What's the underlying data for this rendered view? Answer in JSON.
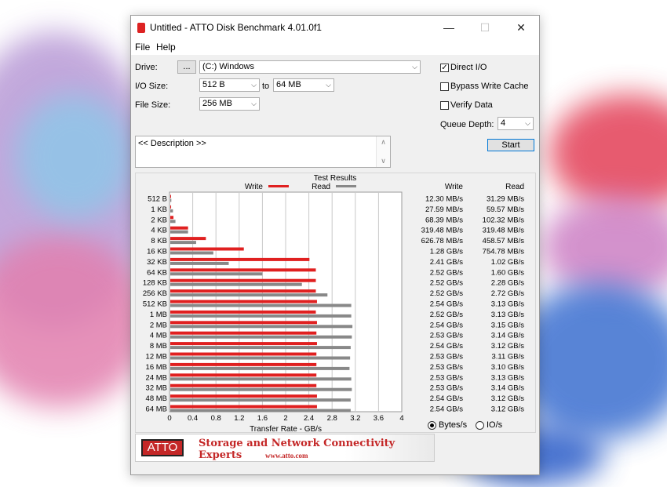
{
  "window": {
    "title": "Untitled - ATTO Disk Benchmark 4.01.0f1",
    "minimize_glyph": "—",
    "maximize_glyph": "☐",
    "close_glyph": "✕"
  },
  "menu": {
    "file": "File",
    "help": "Help"
  },
  "settings": {
    "drive_label": "Drive:",
    "drive_browse": "...",
    "drive_value": "(C:) Windows",
    "io_size_label": "I/O Size:",
    "io_size_from": "512 B",
    "io_to_label": "to",
    "io_size_to": "64 MB",
    "file_size_label": "File Size:",
    "file_size_value": "256 MB",
    "direct_io_label": "Direct I/O",
    "direct_io_checked": true,
    "bypass_write_cache_label": "Bypass Write Cache",
    "verify_data_label": "Verify Data",
    "queue_depth_label": "Queue Depth:",
    "queue_depth_value": "4",
    "start_label": "Start",
    "description": "<< Description >>",
    "check_glyph": "✓",
    "arrow_glyph": "⌵",
    "scroll_up_glyph": "∧",
    "scroll_down_glyph": "∨"
  },
  "results": {
    "write_col": "Write",
    "read_col": "Read",
    "bytes_label": "Bytes/s",
    "io_label": "IO/s",
    "bytes_selected": true
  },
  "chart_data": {
    "type": "bar",
    "title": "Test Results",
    "xlabel": "Transfer Rate - GB/s",
    "xlim": [
      0,
      4
    ],
    "x_ticks": [
      "0",
      "0.4",
      "0.8",
      "1.2",
      "1.6",
      "2",
      "2.4",
      "2.8",
      "3.2",
      "3.6",
      "4"
    ],
    "legend_position": "top",
    "colors": {
      "write": "#e02020",
      "read": "#888888"
    },
    "categories": [
      "512 B",
      "1 KB",
      "2 KB",
      "4 KB",
      "8 KB",
      "16 KB",
      "32 KB",
      "64 KB",
      "128 KB",
      "256 KB",
      "512 KB",
      "1 MB",
      "2 MB",
      "4 MB",
      "8 MB",
      "12 MB",
      "16 MB",
      "24 MB",
      "32 MB",
      "48 MB",
      "64 MB"
    ],
    "series": [
      {
        "name": "Write",
        "values": [
          0.0123,
          0.02759,
          0.06839,
          0.31948,
          0.62678,
          1.28,
          2.41,
          2.52,
          2.52,
          2.52,
          2.54,
          2.52,
          2.54,
          2.53,
          2.54,
          2.53,
          2.53,
          2.53,
          2.53,
          2.54,
          2.54
        ],
        "labels": [
          "12.30 MB/s",
          "27.59 MB/s",
          "68.39 MB/s",
          "319.48 MB/s",
          "626.78 MB/s",
          "1.28 GB/s",
          "2.41 GB/s",
          "2.52 GB/s",
          "2.52 GB/s",
          "2.52 GB/s",
          "2.54 GB/s",
          "2.52 GB/s",
          "2.54 GB/s",
          "2.53 GB/s",
          "2.54 GB/s",
          "2.53 GB/s",
          "2.53 GB/s",
          "2.53 GB/s",
          "2.53 GB/s",
          "2.54 GB/s",
          "2.54 GB/s"
        ]
      },
      {
        "name": "Read",
        "values": [
          0.03129,
          0.05957,
          0.10232,
          0.31948,
          0.45857,
          0.75478,
          1.02,
          1.6,
          2.28,
          2.72,
          3.13,
          3.13,
          3.15,
          3.14,
          3.12,
          3.11,
          3.1,
          3.13,
          3.14,
          3.12,
          3.12
        ],
        "labels": [
          "31.29 MB/s",
          "59.57 MB/s",
          "102.32 MB/s",
          "319.48 MB/s",
          "458.57 MB/s",
          "754.78 MB/s",
          "1.02 GB/s",
          "1.60 GB/s",
          "2.28 GB/s",
          "2.72 GB/s",
          "3.13 GB/s",
          "3.13 GB/s",
          "3.15 GB/s",
          "3.14 GB/s",
          "3.12 GB/s",
          "3.11 GB/s",
          "3.10 GB/s",
          "3.13 GB/s",
          "3.14 GB/s",
          "3.12 GB/s",
          "3.12 GB/s"
        ]
      }
    ]
  },
  "banner": {
    "logo": "ATTO",
    "tagline": "Storage and Network Connectivity Experts",
    "url": "www.atto.com"
  }
}
